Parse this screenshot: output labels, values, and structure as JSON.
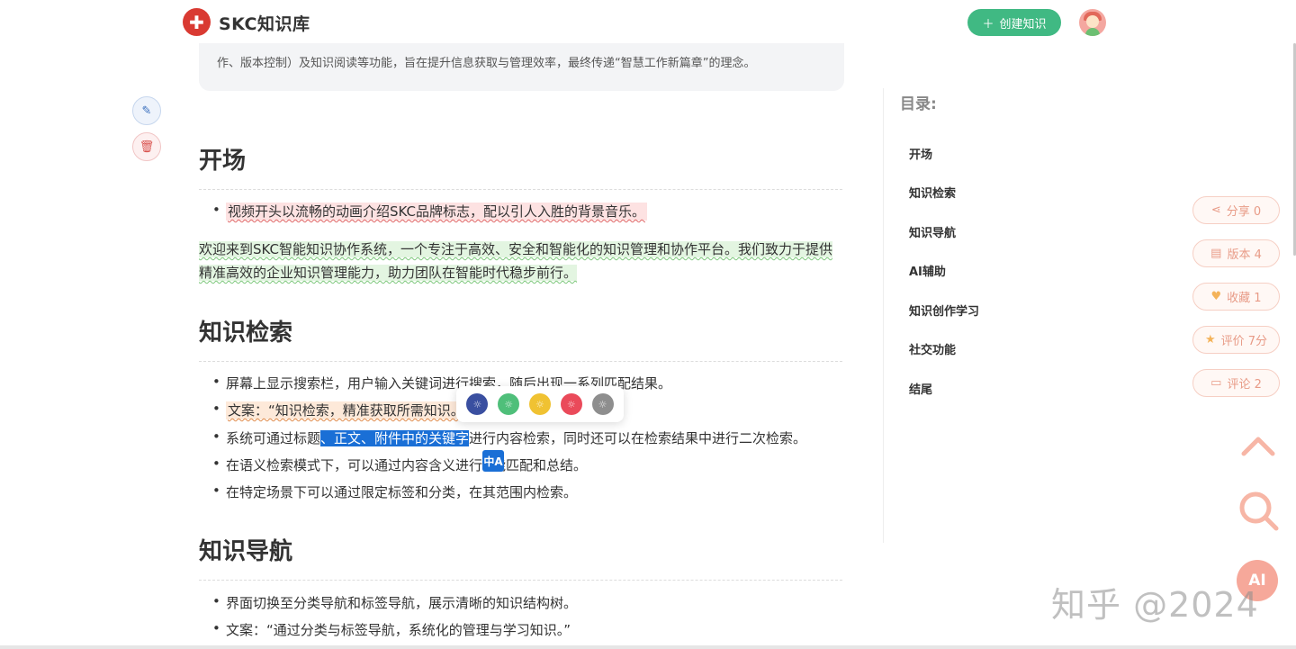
{
  "header": {
    "logo_glyph": "✚",
    "brand": "SKC知识库",
    "create_button": "创建知识",
    "create_icon": "＋"
  },
  "summary": {
    "text": "作、版本控制）及知识阅读等功能，旨在提升信息获取与管理效率，最终传递“智慧工作新篇章”的理念。"
  },
  "side_actions": {
    "edit_icon": "✎",
    "delete_icon": "🗑"
  },
  "sections": {
    "opening": {
      "heading": "开场",
      "bullet1": "视频开头以流畅的动画介绍SKC品牌标志，配以引人入胜的背景音乐。",
      "paragraph": "欢迎来到SKC智能知识协作系统，一个专注于高效、安全和智能化的知识管理和协作平台。我们致力于提供精准高效的企业知识管理能力，助力团队在智能时代稳步前行。"
    },
    "search": {
      "heading": "知识检索",
      "bullet1": "屏幕上显示搜索栏，用户输入关键词进行搜索，随后出现一系列匹配结果。",
      "bullet2": "文案：“知识检索，精准获取所需知识。”",
      "bullet3_pre": "系统可通过标题",
      "bullet3_sel": "、正文、附件中的关键字",
      "bullet3_post": "进行内容检索，同时还可以在检索结果中进行二次检索。",
      "bullet4_pre": "在语义检索模式下，可以通过内容含义进行",
      "bullet4_post": "能匹配和总结。",
      "bullet5": "在特定场景下可以通过限定标签和分类，在其范围内检索。"
    },
    "nav": {
      "heading": "知识导航",
      "bullet1": "界面切换至分类导航和标签导航，展示清晰的知识结构树。",
      "bullet2": "文案：“通过分类与标签导航，系统化的管理与学习知识。”"
    }
  },
  "color_toolbar": {
    "colors": [
      "#3a4fa0",
      "#4fbf7a",
      "#f0c232",
      "#ea4a5a",
      "#8e8e8e"
    ],
    "icon": "☼"
  },
  "translate_chip": "中A",
  "toc": {
    "title": "目录:",
    "items": [
      "开场",
      "知识检索",
      "知识导航",
      "AI辅助",
      "知识创作学习",
      "社交功能",
      "结尾"
    ]
  },
  "pills": {
    "share": {
      "icon": "⋖",
      "label": "分享 0"
    },
    "version": {
      "icon": "▤",
      "label": "版本 4"
    },
    "favorite": {
      "icon": "♥",
      "label": "收藏 1"
    },
    "rating": {
      "icon": "★",
      "label": "评价 7分"
    },
    "comment": {
      "icon": "▭",
      "label": "评论 2"
    }
  },
  "fab": {
    "ai": "AI"
  },
  "watermark": "知乎 @2024",
  "colors": {
    "brand_red": "#d93a32",
    "create_green": "#40b983",
    "selection_blue": "#1a6fd6",
    "pill_text": "#e89b87"
  }
}
